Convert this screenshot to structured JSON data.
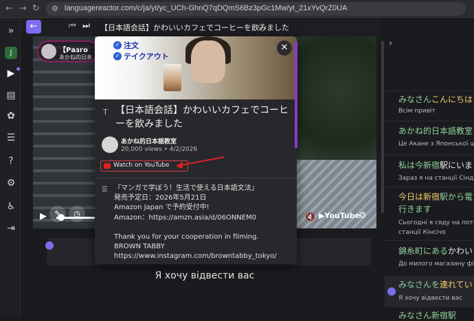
{
  "browser": {
    "url": "languagereactor.com/c/ja/yt/yc_UCh-GhnQ7qDQmS6Bz3pGc1Mw/yt_21xYvQrZ0UA"
  },
  "sidebar": {
    "user_initial": "J",
    "icons": [
      "chevrons-right-icon",
      "user-avatar",
      "play-icon",
      "chat-icon",
      "puzzle-icon",
      "list-icon",
      "help-icon",
      "settings-icon",
      "accessibility-icon",
      "export-icon"
    ]
  },
  "toolbar": {
    "back": "←",
    "title": "【日本語会話】かわいいカフェでコーヒーを飲みました",
    "info": "ⓘ"
  },
  "video": {
    "chip_title": "【Разго",
    "chip_sub": "あかね的日本"
  },
  "popup": {
    "thumb_labels": [
      "注文",
      "テイクアウト"
    ],
    "title": "【日本語会話】かわいいカフェでコーヒーを飲みました",
    "channel": "あかね的日本語教室",
    "meta": "20,000 views • 4/2/2026",
    "watch_label": "Watch on YouTube",
    "description": "『マンガで学ぼう！生活で使える日本語文法』\n発売予定日：2026年5月21日\nAmazon Japan で予約受付中!\nAmazon：https://amzn.asia/d/06ONNEM0\n\nThank you for your cooperation in filming.\nBROWN TABBY\nhttps://www.instagram.com/browntabby_tokyo/"
  },
  "subtitle": {
    "current": "Я хочу відвести вас"
  },
  "transcript": [
    {
      "jp_a": "みなさん",
      "jp_b": "こんにちは",
      "tr": "Всім привіт"
    },
    {
      "jp_a": "あかね的",
      "jp_b": "日本語教室",
      "tr": "Це Акане з Японської шко"
    },
    {
      "jp_a": "私は今新宿",
      "jp_b": "駅にいま",
      "tr": "Зараз я на станції Сіндзюк"
    },
    {
      "jp_a": "今日は新宿",
      "jp_b": "駅から電",
      "jp_c": "行きます",
      "tr": "Сьогодні я сяду на потяг",
      "tr2": "станції Кінсічо"
    },
    {
      "jp_a": "錦糸町にある",
      "jp_b": "かわい",
      "tr": "До милого магазину фіна"
    },
    {
      "jp_a": "みなさんを",
      "jp_b": "連れてい",
      "tr": "Я хочу відвести вас"
    },
    {
      "jp_a": "みなさん",
      "jp_b": "新宿駅",
      "tr": ""
    }
  ],
  "colors": {
    "accent": "#7c6cf0",
    "youtube_red": "#e02020",
    "transcript_green": "#8fd29a",
    "transcript_highlight": "#f3d06b"
  }
}
